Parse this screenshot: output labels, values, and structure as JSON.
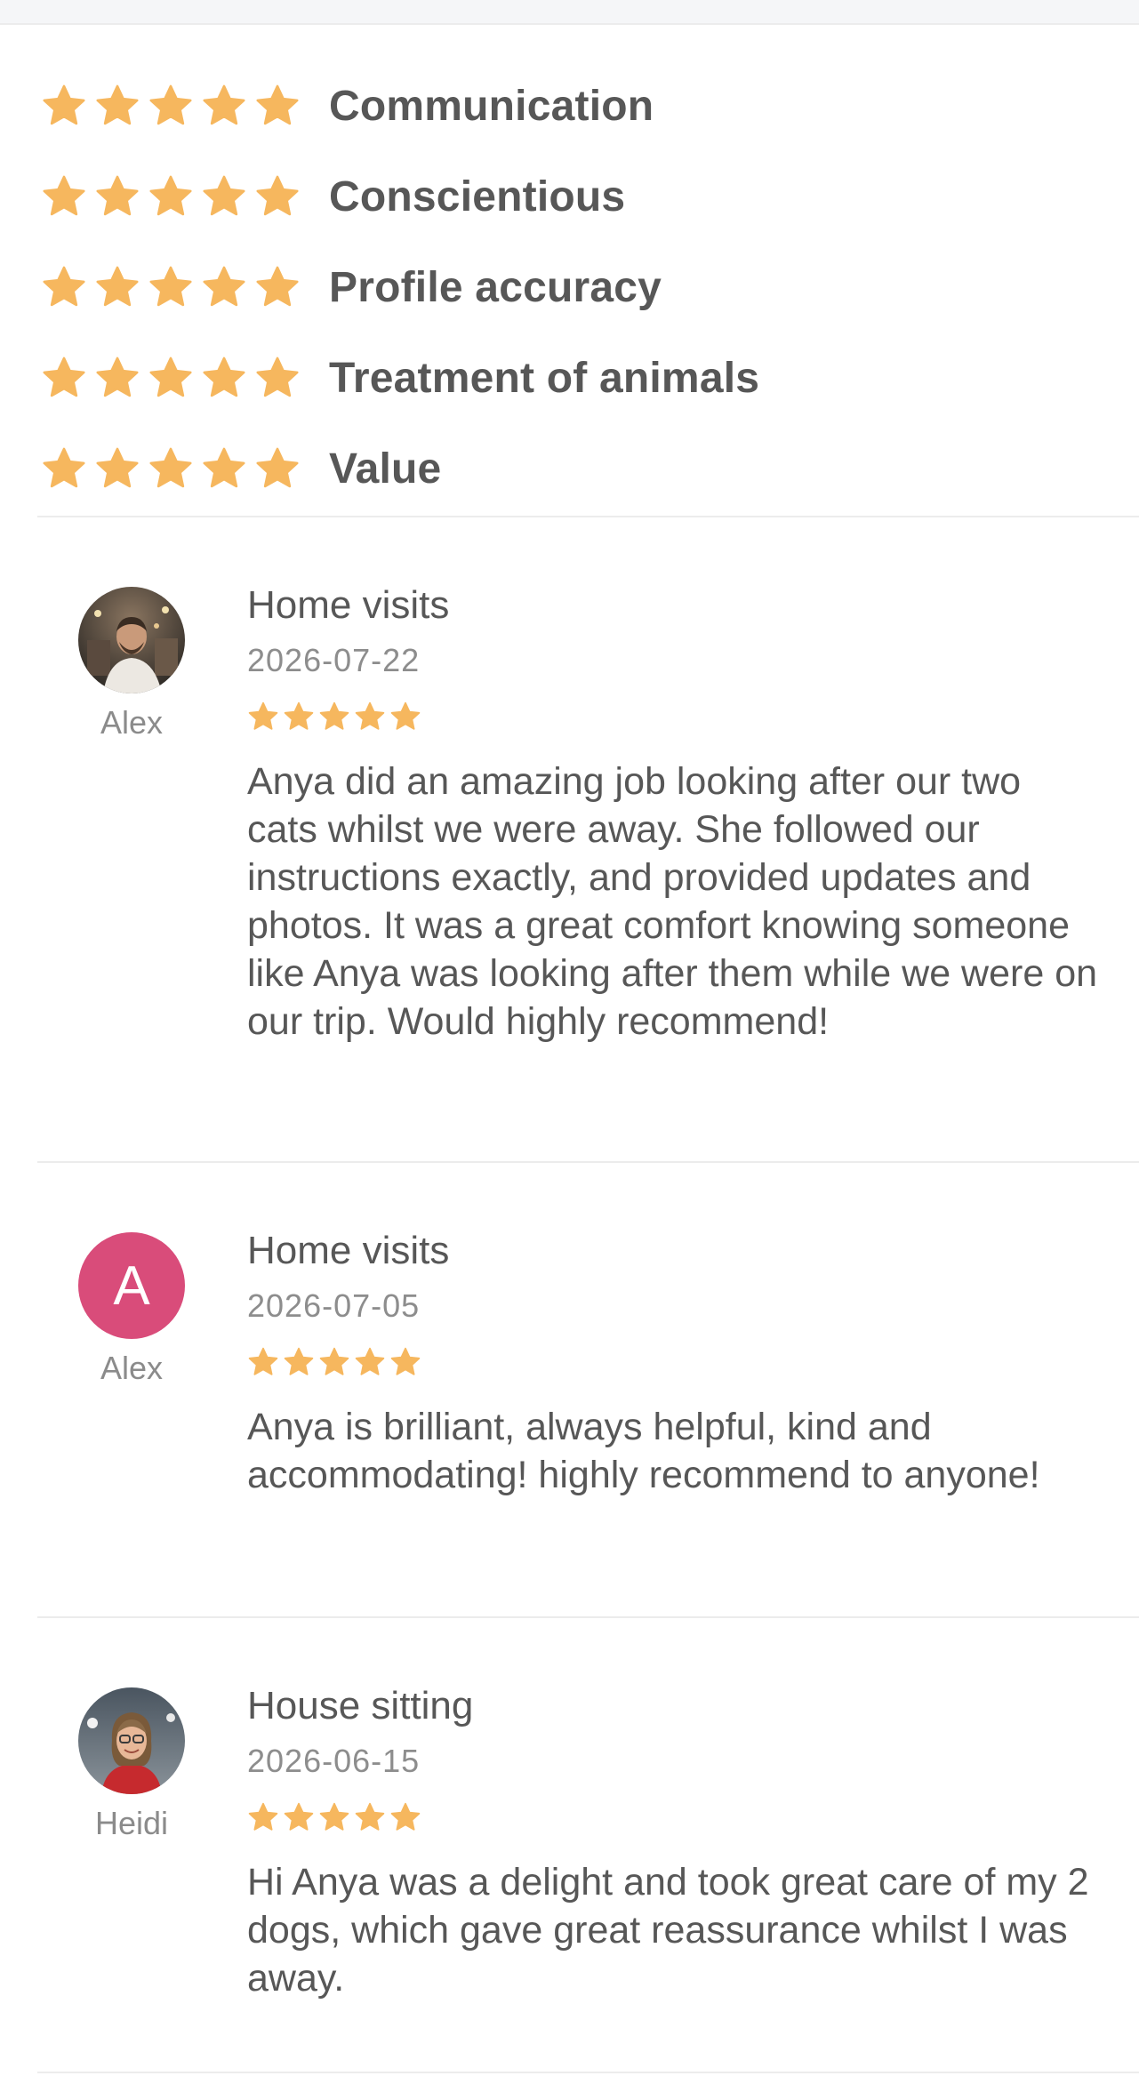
{
  "colors": {
    "star": "#f6b75e",
    "avatar_letter_bg": "#d94c7a",
    "divider": "#ececec"
  },
  "ratings": [
    {
      "label": "Communication",
      "stars": 5
    },
    {
      "label": "Conscientious",
      "stars": 5
    },
    {
      "label": "Profile accuracy",
      "stars": 5
    },
    {
      "label": "Treatment of animals",
      "stars": 5
    },
    {
      "label": "Value",
      "stars": 5
    }
  ],
  "reviews": [
    {
      "name": "Alex",
      "avatar": "photo",
      "service": "Home visits",
      "date": "2026-07-22",
      "stars": 5,
      "text": "Anya did an amazing job looking after our two cats whilst we were away. She followed our instructions exactly, and provided updates and photos. It was a great comfort knowing someone like Anya was looking after them while we were on our trip. Would highly recommend!"
    },
    {
      "name": "Alex",
      "avatar_letter": "A",
      "service": "Home visits",
      "date": "2026-07-05",
      "stars": 5,
      "text": "Anya is brilliant, always helpful, kind and accommodating! highly recommend to anyone!"
    },
    {
      "name": "Heidi",
      "avatar": "photo",
      "service": "House sitting",
      "date": "2026-06-15",
      "stars": 5,
      "text": "Hi Anya was a delight and took great care of my 2 dogs, which gave great reassurance whilst I was away."
    }
  ]
}
